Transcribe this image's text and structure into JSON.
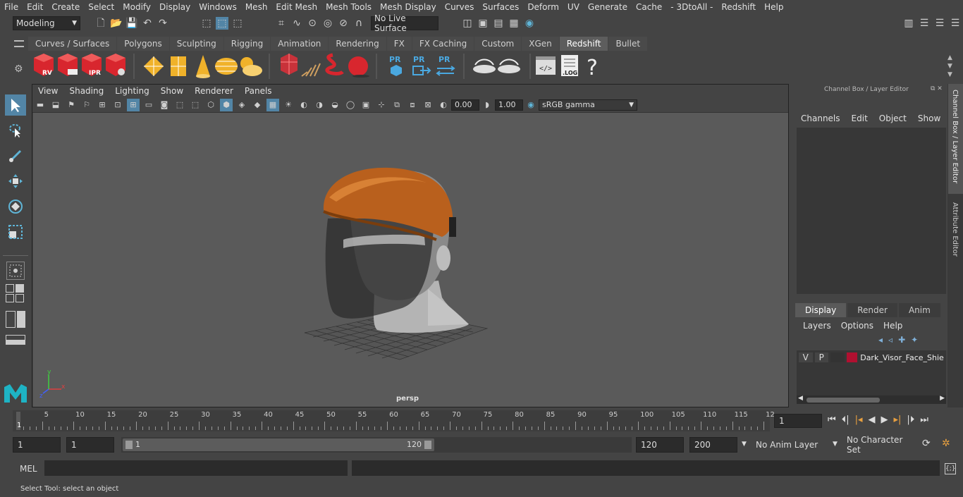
{
  "menu": [
    "File",
    "Edit",
    "Create",
    "Select",
    "Modify",
    "Display",
    "Windows",
    "Mesh",
    "Edit Mesh",
    "Mesh Tools",
    "Mesh Display",
    "Curves",
    "Surfaces",
    "Deform",
    "UV",
    "Generate",
    "Cache",
    "- 3DtoAll -",
    "Redshift",
    "Help"
  ],
  "status": {
    "mode": "Modeling",
    "live_surface": "No Live Surface"
  },
  "shelf_tabs": [
    "Curves / Surfaces",
    "Polygons",
    "Sculpting",
    "Rigging",
    "Animation",
    "Rendering",
    "FX",
    "FX Caching",
    "Custom",
    "XGen",
    "Redshift",
    "Bullet"
  ],
  "shelf_active": "Redshift",
  "shelf_labels": {
    "rv": "RV",
    "ipr": "IPR",
    "pr1": "PR",
    "pr2": "PR",
    "pr3": "PR",
    "log": ".LOG",
    "help": "?"
  },
  "viewport_menu": [
    "View",
    "Shading",
    "Lighting",
    "Show",
    "Renderer",
    "Panels"
  ],
  "viewport_toolbar": {
    "exposure": "0.00",
    "gamma": "1.00",
    "color_space": "sRGB gamma"
  },
  "camera_label": "persp",
  "axis": {
    "x": "x",
    "y": "y",
    "z": "z"
  },
  "channel_box": {
    "title": "Channel Box / Layer Editor",
    "menus": [
      "Channels",
      "Edit",
      "Object",
      "Show"
    ]
  },
  "layer_editor": {
    "tabs": [
      "Display",
      "Render",
      "Anim"
    ],
    "active_tab": "Display",
    "menus": [
      "Layers",
      "Options",
      "Help"
    ],
    "layer": {
      "v": "V",
      "p": "P",
      "name": "Dark_Visor_Face_Shiel",
      "color": "#b01030"
    }
  },
  "side_tabs": [
    "Channel Box / Layer Editor",
    "Attribute Editor"
  ],
  "timeline": {
    "ticks": [
      "5",
      "10",
      "15",
      "20",
      "25",
      "30",
      "35",
      "40",
      "45",
      "50",
      "55",
      "60",
      "65",
      "70",
      "75",
      "80",
      "85",
      "90",
      "95",
      "100",
      "105",
      "110",
      "115",
      "12"
    ],
    "start_label": "1",
    "current_frame": "1"
  },
  "range": {
    "start": "1",
    "start2": "1",
    "slider_start": "1",
    "slider_end": "120",
    "end": "120",
    "max": "200",
    "anim_layer": "No Anim Layer",
    "char_set": "No Character Set"
  },
  "mel": {
    "label": "MEL"
  },
  "help_line": "Select Tool: select an object",
  "colors": {
    "accent": "#5285a6",
    "helmet": "#c0621c",
    "layer_swatch": "#b01030"
  }
}
